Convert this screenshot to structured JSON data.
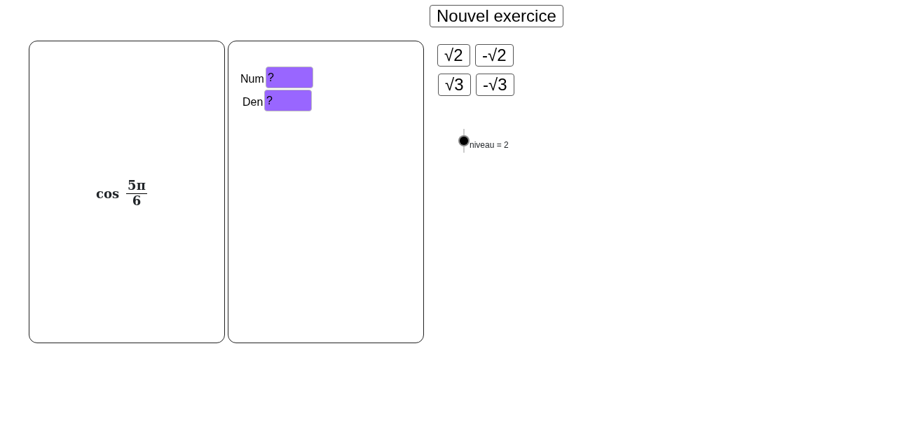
{
  "new_exercise_button": "Nouvel exercice",
  "expression": {
    "function": "cos",
    "numerator": "5π",
    "denominator": "6"
  },
  "fields": [
    {
      "label": "Num",
      "value": "?"
    },
    {
      "label": "Den",
      "value": "?"
    }
  ],
  "root_buttons": [
    [
      "√2",
      "-√2"
    ],
    [
      "√3",
      "-√3"
    ]
  ],
  "point_label": "niveau = 2"
}
